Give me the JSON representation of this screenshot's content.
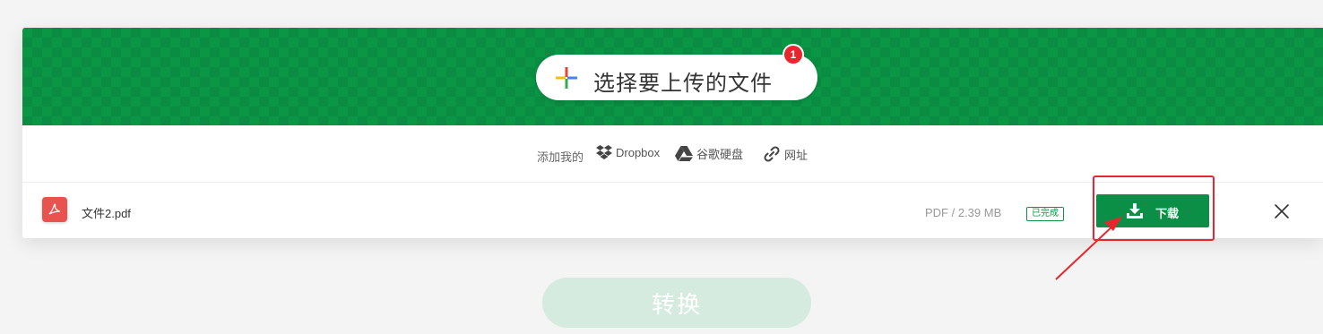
{
  "upload": {
    "choose_label": "选择要上传的文件",
    "file_count_badge": "1"
  },
  "sources": {
    "prefix": "添加我的",
    "items": [
      {
        "label": "Dropbox",
        "icon": "dropbox-icon"
      },
      {
        "label": "谷歌硬盘",
        "icon": "google-drive-icon"
      },
      {
        "label": "网址",
        "icon": "link-icon"
      }
    ]
  },
  "file": {
    "name": "文件2.pdf",
    "meta": "PDF / 2.39 MB",
    "status": "已完成",
    "download_label": "下载",
    "icon": "pdf-file-icon"
  },
  "actions": {
    "convert_label": "转换"
  },
  "colors": {
    "brand_green": "#0b9646",
    "download_green": "#0b8f47",
    "convert_disabled": "#d6ebe0",
    "badge_red": "#e8262d",
    "annotation_red": "#e8262d"
  }
}
